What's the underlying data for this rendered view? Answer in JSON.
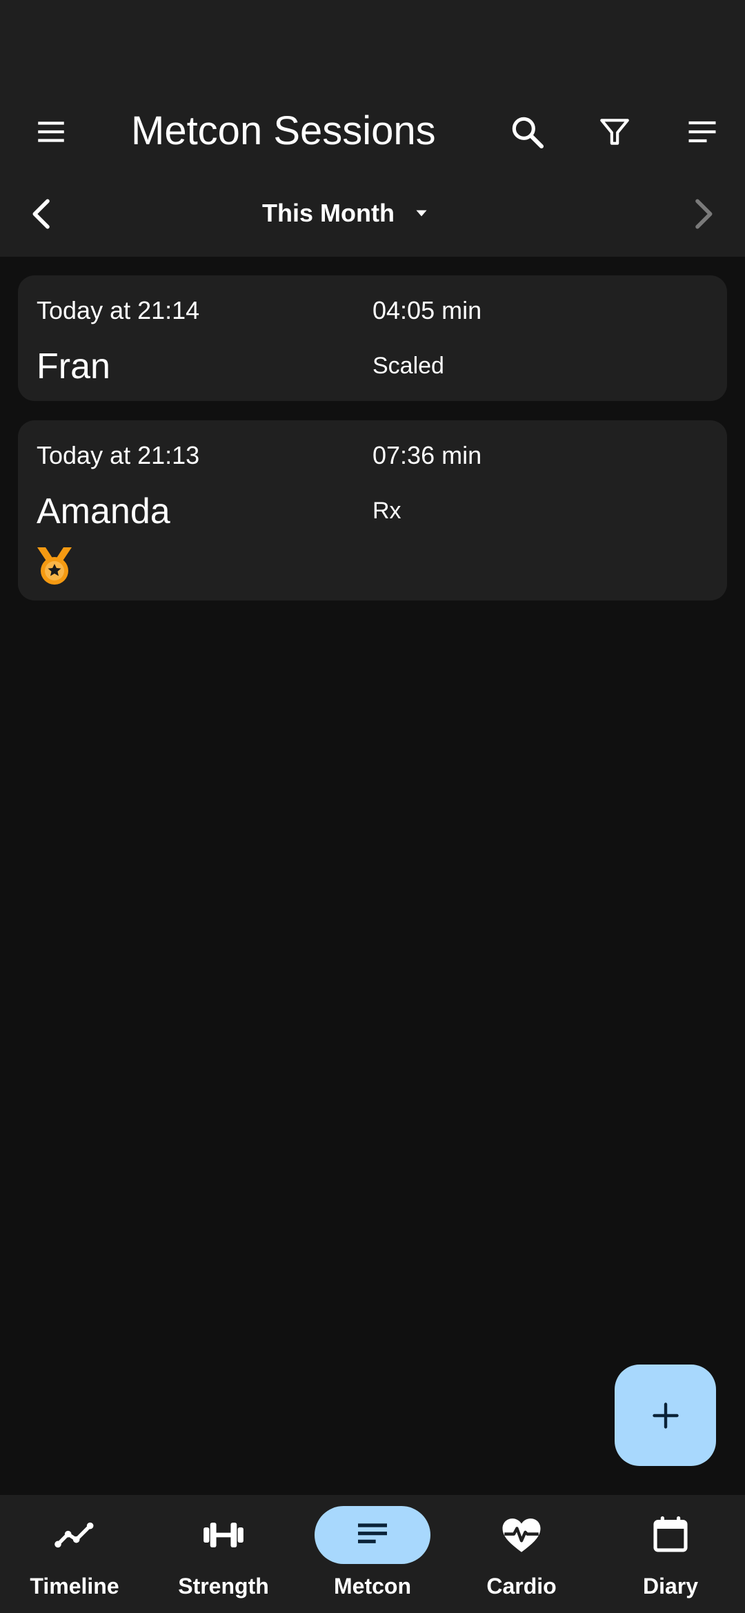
{
  "app_bar": {
    "title": "Metcon Sessions",
    "icons": {
      "menu": "menu-icon",
      "search": "search-icon",
      "filter": "filter-icon",
      "sort": "sort-icon"
    }
  },
  "date_range": {
    "label": "This Month",
    "prev_icon": "chevron-left-icon",
    "next_icon": "chevron-right-icon",
    "dropdown_icon": "arrow-drop-down-icon"
  },
  "sessions": [
    {
      "when": "Today at 21:14",
      "duration": "04:05 min",
      "name": "Fran",
      "category": "Scaled",
      "personal_record": false
    },
    {
      "when": "Today at 21:13",
      "duration": "07:36 min",
      "name": "Amanda",
      "category": "Rx",
      "personal_record": true
    }
  ],
  "fab": {
    "icon": "add-icon"
  },
  "bottom_nav": {
    "items": [
      {
        "label": "Timeline",
        "icon": "timeline-icon",
        "active": false
      },
      {
        "label": "Strength",
        "icon": "dumbbell-icon",
        "active": false
      },
      {
        "label": "Metcon",
        "icon": "notes-icon",
        "active": true
      },
      {
        "label": "Cardio",
        "icon": "heart-pulse-icon",
        "active": false
      },
      {
        "label": "Diary",
        "icon": "calendar-icon",
        "active": false
      }
    ]
  },
  "colors": {
    "background": "#101010",
    "surface": "#1f1f1f",
    "card": "#202020",
    "accent": "#a8d8fd",
    "medal": "#f59a12",
    "disabled": "#7a7a7a"
  }
}
